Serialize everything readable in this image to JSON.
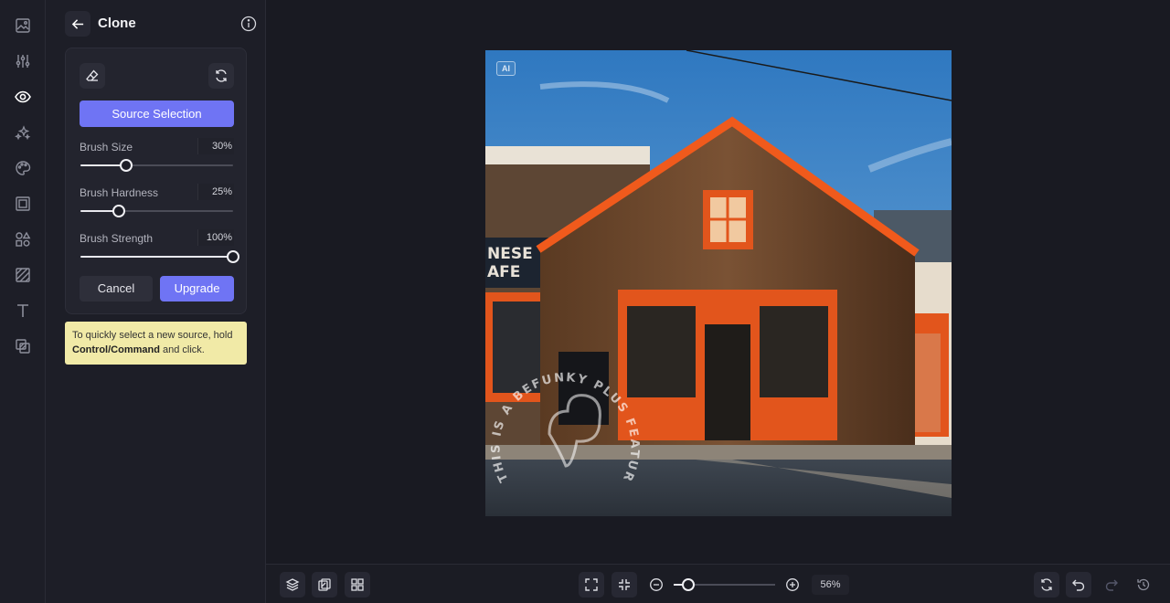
{
  "rail": {
    "items": [
      "image-icon",
      "adjust-sliders-icon",
      "eye-icon",
      "sparkles-icon",
      "palette-icon",
      "frame-icon",
      "shapes-icon",
      "texture-icon",
      "text-icon",
      "overlay-icon"
    ],
    "active": "eye-icon"
  },
  "panel": {
    "title": "Clone",
    "source_button": "Source Selection",
    "sliders": [
      {
        "label": "Brush Size",
        "value_text": "30%",
        "value": 30
      },
      {
        "label": "Brush Hardness",
        "value_text": "25%",
        "value": 25
      },
      {
        "label": "Brush Strength",
        "value_text": "100%",
        "value": 100
      }
    ],
    "cancel_label": "Cancel",
    "upgrade_label": "Upgrade",
    "tip": {
      "text_before": "To quickly select a new source, hold ",
      "shortcut": "Control/Command",
      "text_after": " and click."
    }
  },
  "canvas": {
    "ai_badge": "AI",
    "sign_line1": "NESE",
    "sign_line2": "AFE",
    "watermark": "THIS IS A BEFUNKY PLUS FEATURE •"
  },
  "bottombar": {
    "zoom_value_text": "56%",
    "zoom_value": 56
  },
  "colors": {
    "accent": "#6f74f4",
    "tip_background": "#f1eaa7",
    "panel_background": "#1d1e27"
  }
}
